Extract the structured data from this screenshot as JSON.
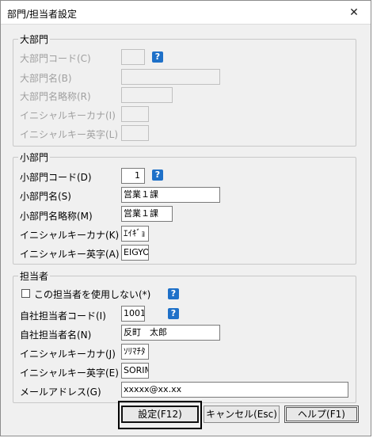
{
  "window": {
    "title": "部門/担当者設定",
    "close_icon": "✕"
  },
  "group_large": {
    "title": "大部門",
    "code_label": "大部門コード(C)",
    "name_label": "大部門名(B)",
    "short_label": "大部門名略称(R)",
    "kana_label": "イニシャルキーカナ(I)",
    "eng_label": "イニシャルキー英字(L)",
    "code_value": "",
    "name_value": "",
    "short_value": "",
    "kana_value": "",
    "eng_value": ""
  },
  "group_small": {
    "title": "小部門",
    "code_label": "小部門コード(D)",
    "name_label": "小部門名(S)",
    "short_label": "小部門名略称(M)",
    "kana_label": "イニシャルキーカナ(K)",
    "eng_label": "イニシャルキー英字(A)",
    "code_value": "1",
    "name_value": "営業１課",
    "short_value": "営業１課",
    "kana_value": "ｴｲｷﾞｮ",
    "eng_value": "EIGYO"
  },
  "group_staff": {
    "title": "担当者",
    "no_use_label": "この担当者を使用しない(*)",
    "code_label": "自社担当者コード(I)",
    "name_label": "自社担当者名(N)",
    "kana_label": "イニシャルキーカナ(J)",
    "eng_label": "イニシャルキー英字(E)",
    "mail_label": "メールアドレス(G)",
    "code_value": "1001",
    "name_value": "反町　太郎",
    "kana_value": "ｿﾘﾏﾁﾀ",
    "eng_value": "SORIM",
    "mail_value": "xxxxx@xx.xx",
    "no_use_checked": false
  },
  "help_glyph": "?",
  "buttons": {
    "set_label": "設定(F12)",
    "cancel_label": "キャンセル(Esc)",
    "help_label": "ヘルプ(F1)"
  }
}
